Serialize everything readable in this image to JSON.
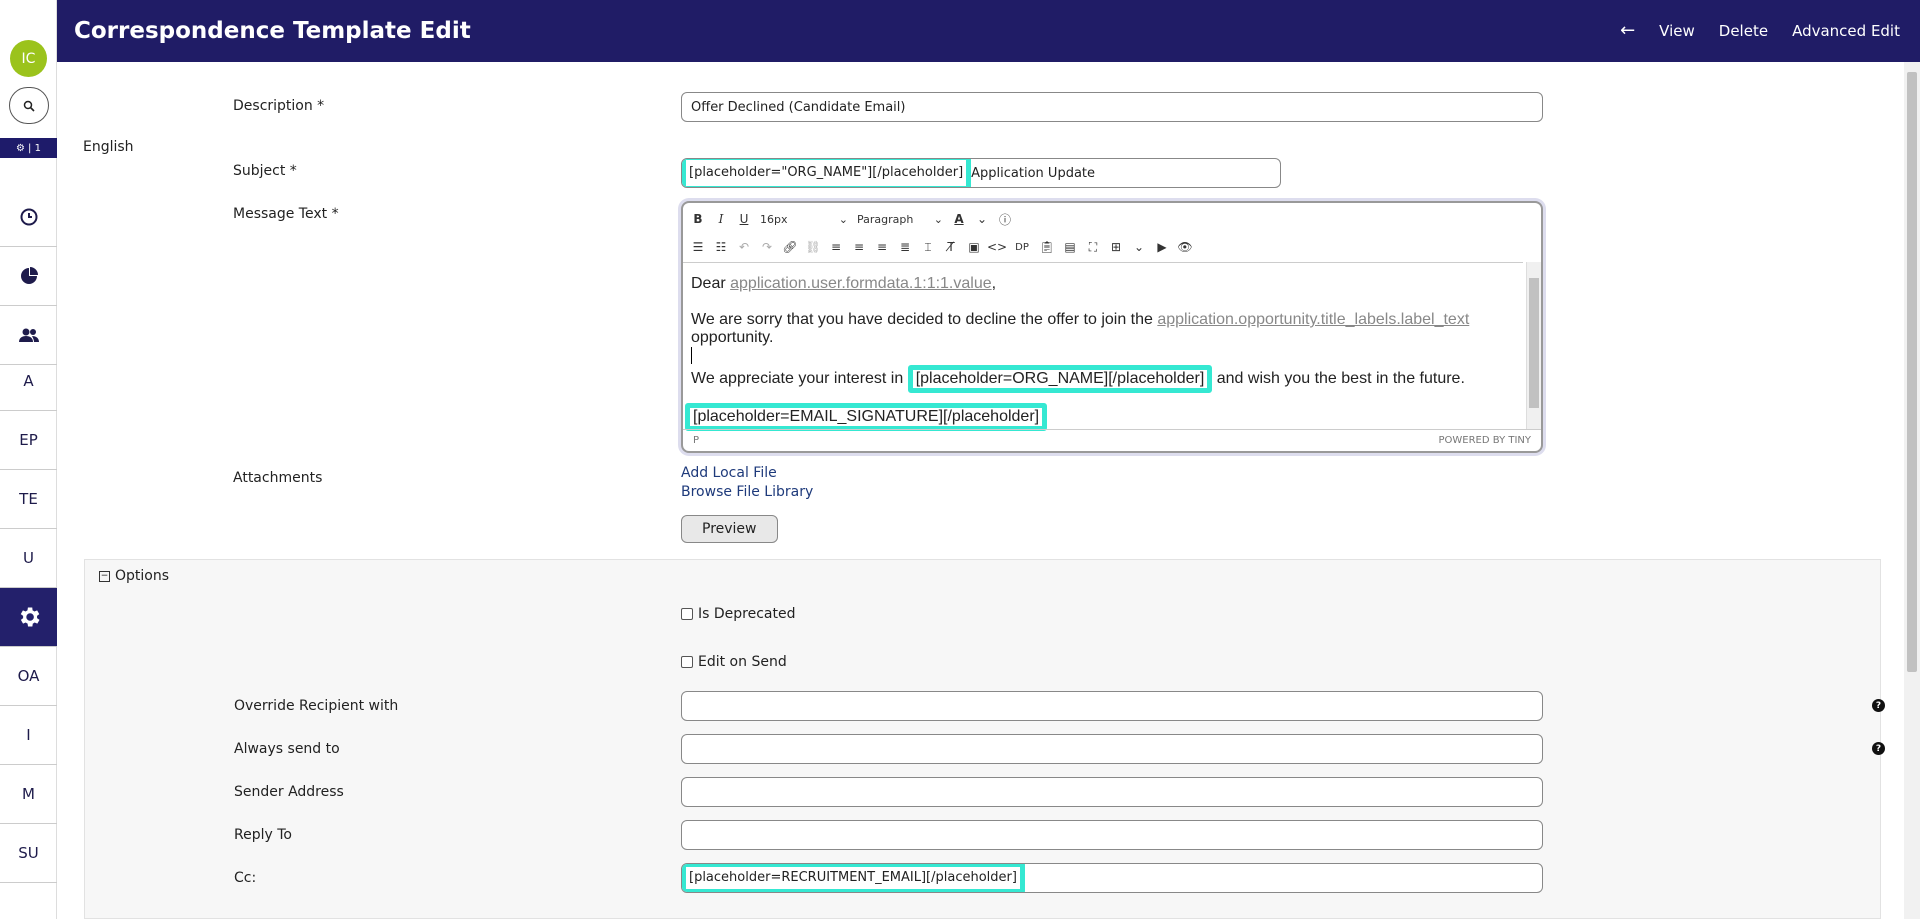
{
  "sidebar": {
    "avatar": "IC",
    "badge": "| 1",
    "items": [
      {
        "label": "",
        "icon": "clock-icon"
      },
      {
        "label": "",
        "icon": "pie-chart-icon"
      },
      {
        "label": "",
        "icon": "users-icon"
      },
      {
        "label": "A"
      },
      {
        "label": "EP"
      },
      {
        "label": "TE"
      },
      {
        "label": "U"
      },
      {
        "label": "",
        "icon": "gear-icon"
      },
      {
        "label": "OA"
      },
      {
        "label": "I"
      },
      {
        "label": "M"
      },
      {
        "label": "SU"
      }
    ]
  },
  "header": {
    "title": "Correspondence Template Edit",
    "actions": [
      "View",
      "Delete",
      "Advanced Edit"
    ]
  },
  "form": {
    "description_label": "Description *",
    "description_value": "Offer Declined (Candidate Email)",
    "language": "English",
    "subject_label": "Subject *",
    "subject_placeholder": "[placeholder=\"ORG_NAME\"][/placeholder]",
    "subject_rest": " Application Update",
    "message_label": "Message Text *",
    "attachments_label": "Attachments",
    "add_local_file": "Add Local File",
    "browse_file_library": "Browse File Library",
    "preview_button": "Preview"
  },
  "editor": {
    "font_size": "16px",
    "block_format": "Paragraph",
    "dp_label": "DP",
    "line1_prefix": "Dear ",
    "line1_ph": "application.user.formdata.1:1:1.value",
    "line1_suffix": ",",
    "line2_prefix": "We are sorry that you have decided to decline the offer to join the ",
    "line2_ph": "application.opportunity.title_labels.label_text",
    "line2_suffix": " opportunity.",
    "line3_prefix": "We appreciate your interest in ",
    "line3_ph": "[placeholder=ORG_NAME][/placeholder]",
    "line3_suffix": " and wish you the best in the future.",
    "line4_ph": "[placeholder=EMAIL_SIGNATURE][/placeholder]",
    "status_path": "P",
    "powered_by": "POWERED BY TINY"
  },
  "options": {
    "title": "Options",
    "is_deprecated": "Is Deprecated",
    "edit_on_send": "Edit on Send",
    "override_recipient": "Override Recipient with",
    "always_send_to": "Always send to",
    "sender_address": "Sender Address",
    "reply_to": "Reply To",
    "cc": "Cc:",
    "cc_value": "[placeholder=RECRUITMENT_EMAIL][/placeholder]"
  },
  "colors": {
    "header_bg": "#201c66",
    "highlight": "#35e8d2",
    "avatar": "#9bc31c"
  }
}
